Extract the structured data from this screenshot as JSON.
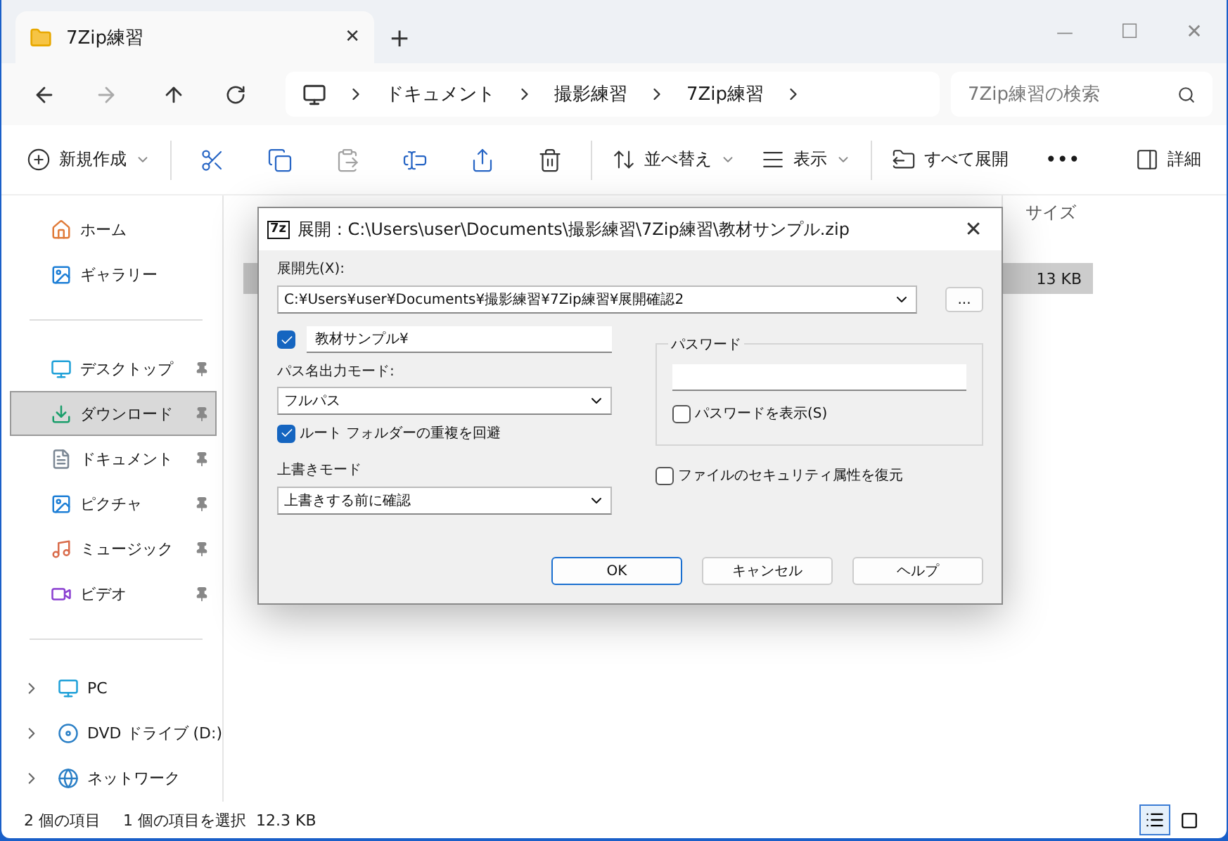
{
  "tab": {
    "title": "7Zip練習",
    "close": "✕",
    "new": "+"
  },
  "window_controls": {
    "minimize": "—",
    "maximize": "☐",
    "close": "✕"
  },
  "breadcrumb": [
    "ドキュメント",
    "撮影練習",
    "7Zip練習"
  ],
  "search": {
    "placeholder": "7Zip練習の検索"
  },
  "toolbar": [
    {
      "kind": "labeled",
      "label": "新規作成",
      "caret": true
    },
    {
      "kind": "icon",
      "disabled": false
    },
    {
      "kind": "icon",
      "disabled": false
    },
    {
      "kind": "icon",
      "disabled": true
    },
    {
      "kind": "icon",
      "disabled": false
    },
    {
      "kind": "icon",
      "disabled": false
    },
    {
      "kind": "icon",
      "disabled": false
    },
    {
      "kind": "labeled",
      "label": "並べ替え",
      "caret": true
    },
    {
      "kind": "labeled",
      "label": "表示",
      "caret": true
    },
    {
      "kind": "labeled",
      "label": "すべて展開",
      "caret": false
    },
    {
      "kind": "more",
      "label": "•••"
    },
    {
      "kind": "labeled",
      "label": "詳細",
      "caret": false
    }
  ],
  "sidebar": {
    "groups": [
      [
        {
          "label": "ホーム",
          "pinned": false,
          "selected": false,
          "expandable": false
        },
        {
          "label": "ギャラリー",
          "pinned": false,
          "selected": false,
          "expandable": false
        }
      ],
      [
        {
          "label": "デスクトップ",
          "pinned": true,
          "selected": false,
          "expandable": false
        },
        {
          "label": "ダウンロード",
          "pinned": true,
          "selected": true,
          "expandable": false
        },
        {
          "label": "ドキュメント",
          "pinned": true,
          "selected": false,
          "expandable": false
        },
        {
          "label": "ピクチャ",
          "pinned": true,
          "selected": false,
          "expandable": false
        },
        {
          "label": "ミュージック",
          "pinned": true,
          "selected": false,
          "expandable": false
        },
        {
          "label": "ビデオ",
          "pinned": true,
          "selected": false,
          "expandable": false
        }
      ],
      [
        {
          "label": "PC",
          "pinned": false,
          "selected": false,
          "expandable": true
        },
        {
          "label": "DVD ドライブ (D:)",
          "pinned": false,
          "selected": false,
          "expandable": true
        },
        {
          "label": "ネットワーク",
          "pinned": false,
          "selected": false,
          "expandable": true
        }
      ]
    ]
  },
  "file_list": {
    "column_4": "サイズ",
    "rows": [
      {
        "size": "",
        "selected": false
      },
      {
        "size": "13 KB",
        "selected": true
      }
    ]
  },
  "status_bar": {
    "count": "2 個の項目",
    "selection": "1 個の項目を選択  12.3 KB",
    "views": [
      {
        "selected": true
      },
      {
        "selected": false
      }
    ]
  },
  "dialog": {
    "app_icon": "7z",
    "title": "展開 : C:\\Users\\user\\Documents\\撮影練習\\7Zip練習\\教材サンプル.zip",
    "close": "✕",
    "destination_label": "展開先(X):",
    "destination": "C:¥Users¥user¥Documents¥撮影練習¥7Zip練習¥展開確認2",
    "browse": "...",
    "subfolder": {
      "checked": true,
      "value": "教材サンプル¥"
    },
    "path_mode_label": "パス名出力モード:",
    "path_mode": "フルパス",
    "avoid_root": {
      "checked": true,
      "label": "ルート フォルダーの重複を回避"
    },
    "overwrite_label": "上書きモード",
    "overwrite": "上書きする前に確認",
    "password_group": "パスワード",
    "show_password": {
      "checked": false,
      "label": "パスワードを表示(S)"
    },
    "restore_security": {
      "checked": false,
      "label": "ファイルのセキュリティ属性を復元"
    },
    "buttons": [
      {
        "label": "OK",
        "default": true
      },
      {
        "label": "キャンセル",
        "default": false
      },
      {
        "label": "ヘルプ",
        "default": false
      }
    ]
  }
}
